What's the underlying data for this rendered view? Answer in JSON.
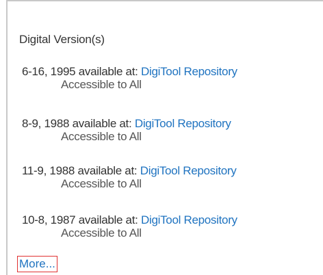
{
  "section": {
    "heading": "Digital Version(s)"
  },
  "versions": [
    {
      "date": "6-16, 1995",
      "available_text": "available at:",
      "link": "DigiTool Repository",
      "access": "Accessible to All"
    },
    {
      "date": "8-9, 1988",
      "available_text": "available at:",
      "link": "DigiTool Repository",
      "access": "Accessible to All"
    },
    {
      "date": "11-9, 1988",
      "available_text": "available at:",
      "link": "DigiTool Repository",
      "access": "Accessible to All"
    },
    {
      "date": "10-8, 1987",
      "available_text": "available at:",
      "link": "DigiTool Repository",
      "access": "Accessible to All"
    }
  ],
  "more_link": "More...",
  "colors": {
    "link": "#1f73c0",
    "text": "#333333",
    "highlight_border": "#e03030"
  }
}
